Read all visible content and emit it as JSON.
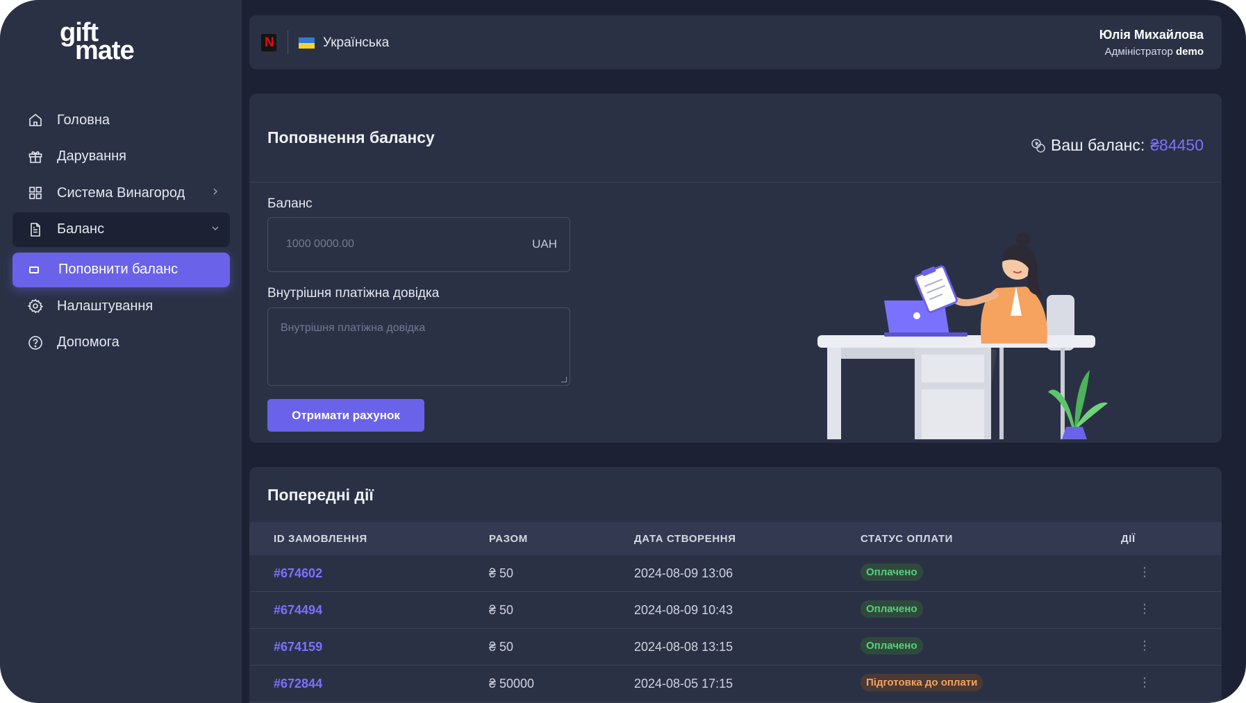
{
  "brand": {
    "line1": "gift",
    "line2": "mate"
  },
  "sidebar": {
    "items": [
      {
        "label": "Головна",
        "icon": "home-icon"
      },
      {
        "label": "Дарування",
        "icon": "gift-icon"
      },
      {
        "label": "Система Винагород",
        "icon": "grid-icon"
      },
      {
        "label": "Баланс",
        "icon": "document-icon"
      },
      {
        "label": "Поповнити баланс",
        "icon": "card-icon"
      },
      {
        "label": "Налаштування",
        "icon": "gear-icon"
      },
      {
        "label": "Допомога",
        "icon": "help-icon"
      }
    ]
  },
  "header": {
    "language": "Українська",
    "user_name": "Юлія Михайлова",
    "user_role": "Адміністратор",
    "user_org": "demo"
  },
  "topup": {
    "title": "Поповнення балансу",
    "balance_label": "Ваш баланс:",
    "balance_amount": "₴84450",
    "amount_label": "Баланс",
    "amount_placeholder": "1000 0000.00",
    "amount_currency": "UAH",
    "reference_label": "Внутрішня платіжна довідка",
    "reference_placeholder": "Внутрішня платіжна довідка",
    "submit_label": "Отримати рахунок"
  },
  "history": {
    "title": "Попередні дії",
    "columns": [
      "ID ЗАМОВЛЕННЯ",
      "РАЗОМ",
      "ДАТА СТВОРЕННЯ",
      "СТАТУС ОПЛАТИ",
      "ДІЇ"
    ],
    "rows": [
      {
        "id": "#674602",
        "total": "₴ 50",
        "date": "2024-08-09 13:06",
        "status": "Оплачено",
        "status_type": "paid"
      },
      {
        "id": "#674494",
        "total": "₴ 50",
        "date": "2024-08-09 10:43",
        "status": "Оплачено",
        "status_type": "paid"
      },
      {
        "id": "#674159",
        "total": "₴ 50",
        "date": "2024-08-08 13:15",
        "status": "Оплачено",
        "status_type": "paid"
      },
      {
        "id": "#672844",
        "total": "₴ 50000",
        "date": "2024-08-05 17:15",
        "status": "Підготовка до оплати",
        "status_type": "pending"
      }
    ],
    "actions_glyph": "⋮"
  },
  "colors": {
    "accent": "#6a62e8",
    "page_bg": "#1c2233",
    "card_bg": "#2b3145",
    "paid": "#56d07a",
    "pending": "#f5a35e"
  }
}
